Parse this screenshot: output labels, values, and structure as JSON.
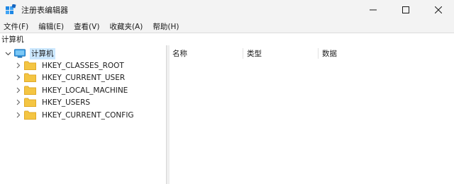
{
  "window": {
    "title": "注册表编辑器",
    "icons": {
      "app": "registry-editor-icon",
      "minimize": "minimize-icon",
      "maximize": "maximize-icon",
      "close": "close-icon"
    }
  },
  "menu": [
    {
      "label": "文件(F)"
    },
    {
      "label": "编辑(E)"
    },
    {
      "label": "查看(V)"
    },
    {
      "label": "收藏夹(A)"
    },
    {
      "label": "帮助(H)"
    }
  ],
  "address": {
    "path": "计算机"
  },
  "tree": {
    "root": {
      "label": "计算机",
      "expanded": true,
      "selected": true
    },
    "children": [
      {
        "label": "HKEY_CLASSES_ROOT"
      },
      {
        "label": "HKEY_CURRENT_USER"
      },
      {
        "label": "HKEY_LOCAL_MACHINE"
      },
      {
        "label": "HKEY_USERS"
      },
      {
        "label": "HKEY_CURRENT_CONFIG"
      }
    ]
  },
  "list": {
    "columns": [
      {
        "label": "名称"
      },
      {
        "label": "类型"
      },
      {
        "label": "数据"
      }
    ]
  },
  "colors": {
    "folder": "#f4c542",
    "folder_dark": "#e0a928",
    "selection": "#cce8ff",
    "chrome": "#f3f3f3"
  }
}
